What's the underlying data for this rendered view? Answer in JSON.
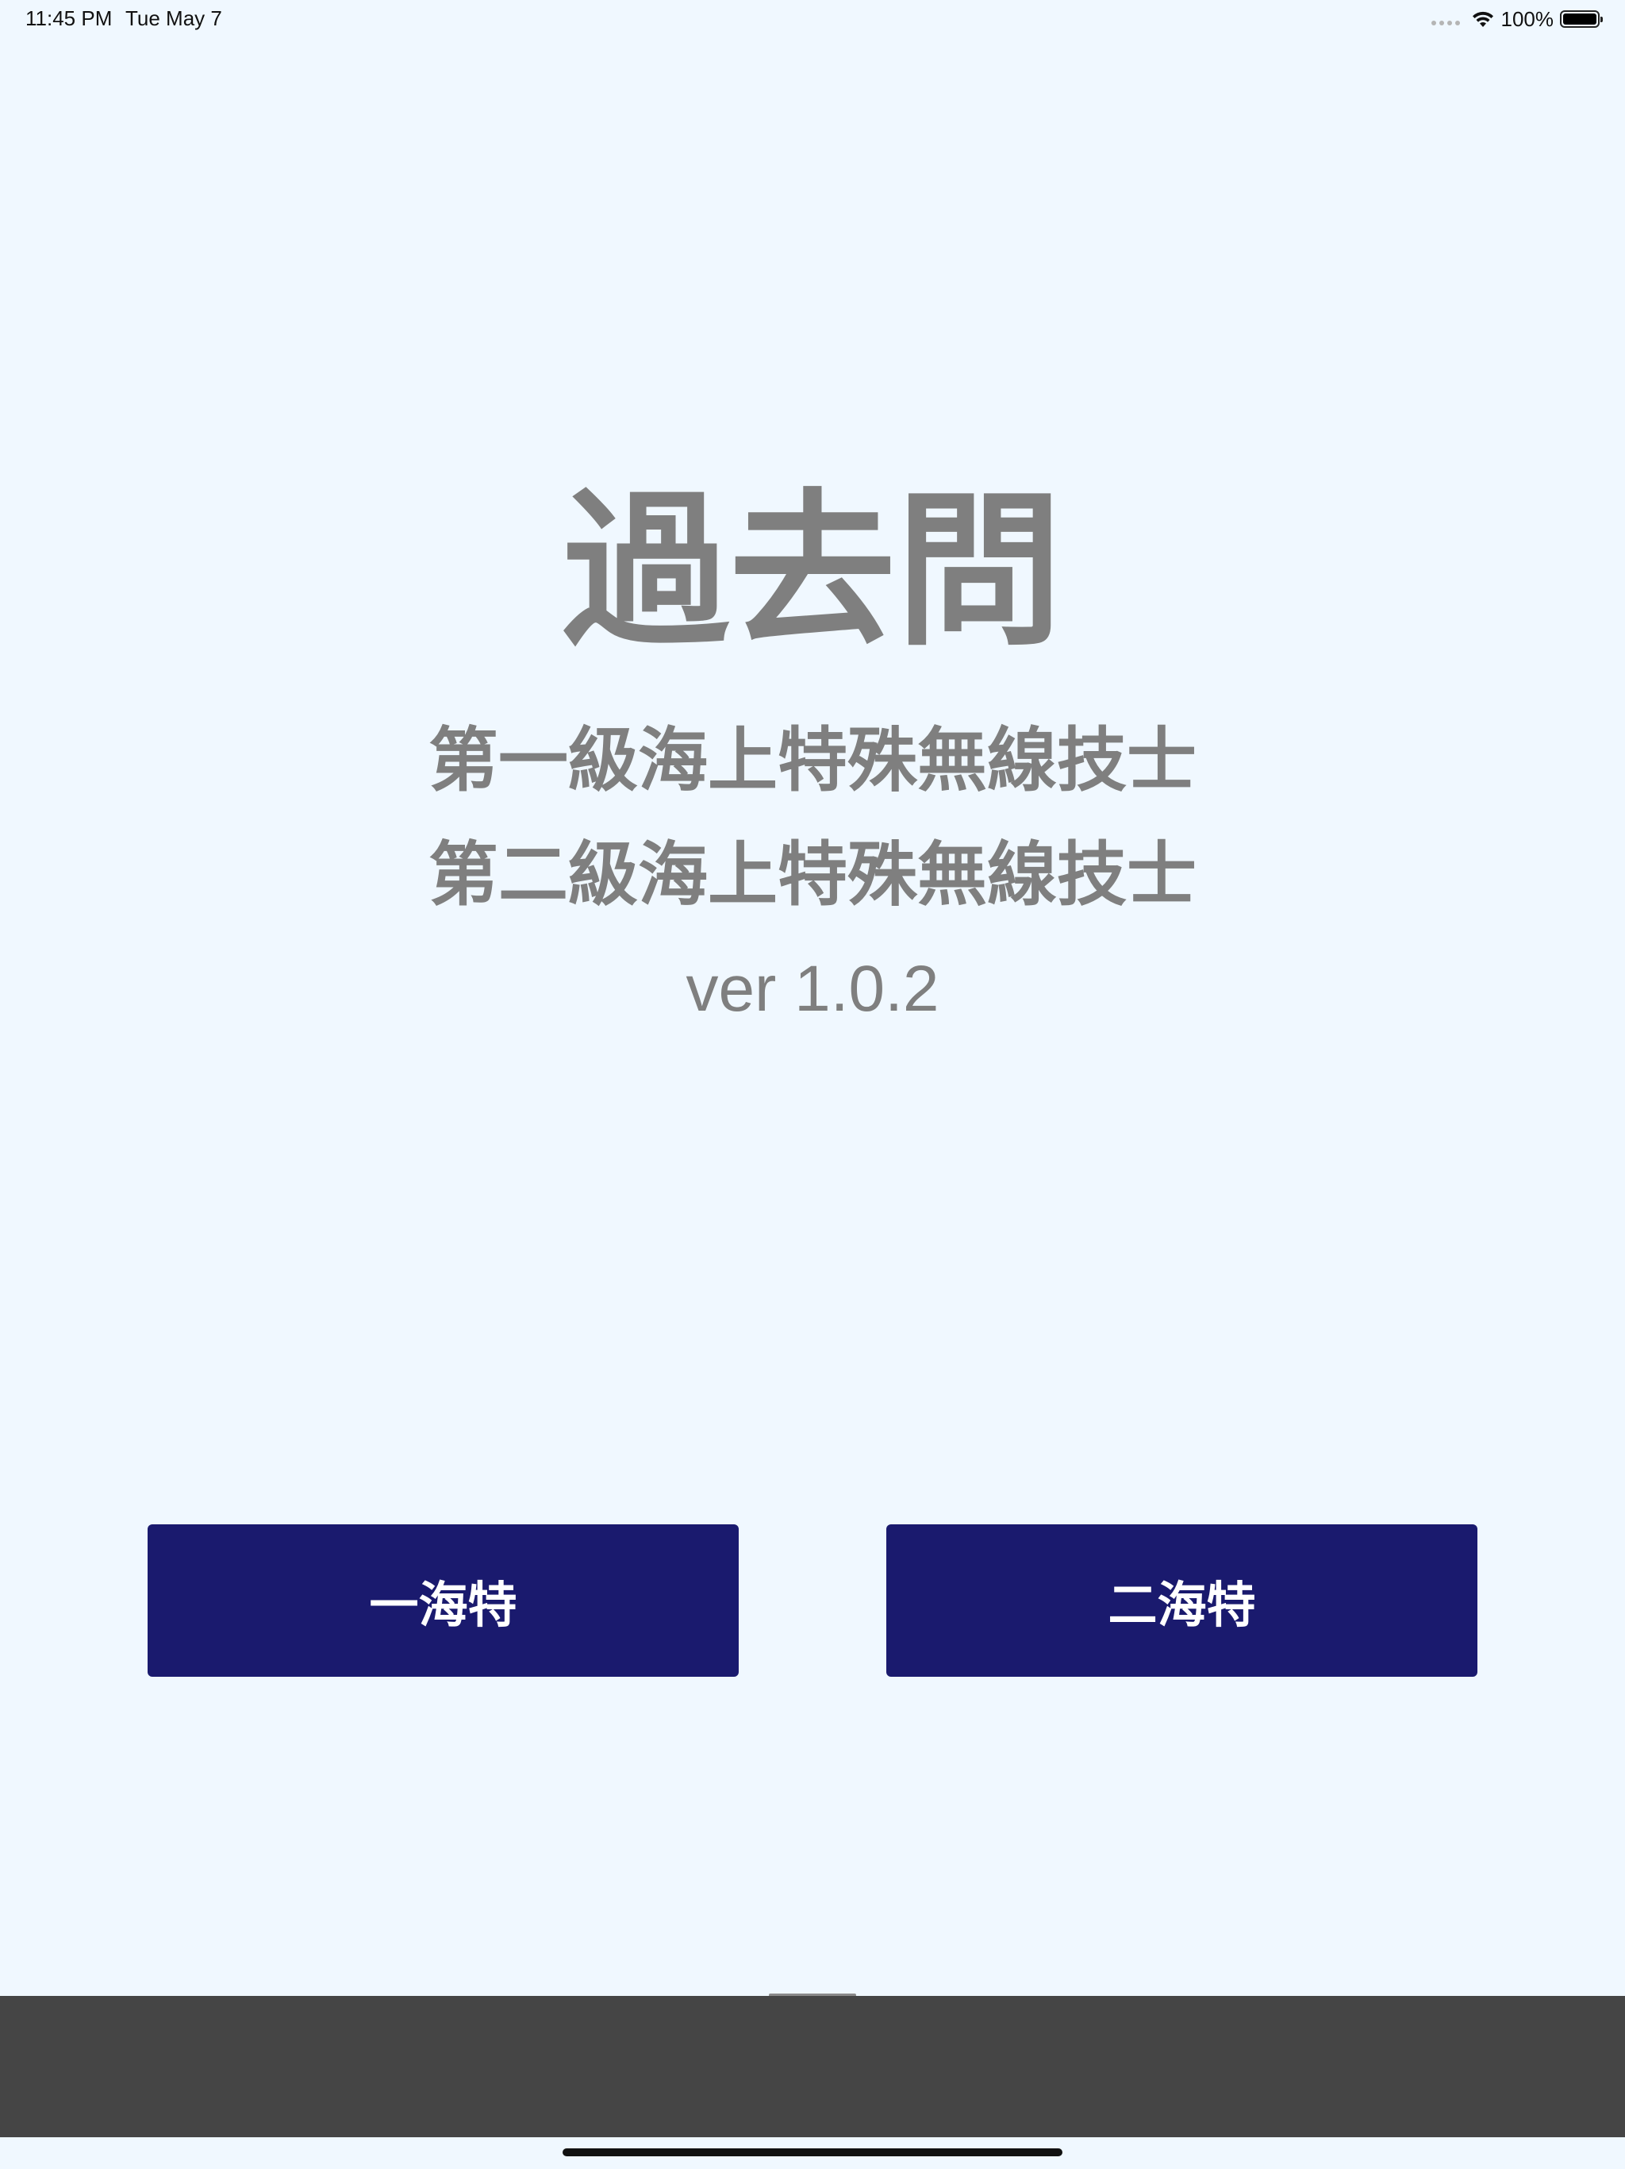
{
  "status_bar": {
    "time": "11:45 PM",
    "date": "Tue May 7",
    "battery": "100%"
  },
  "main": {
    "title": "過去問",
    "subtitle_1": "第一級海上特殊無線技士",
    "subtitle_2": "第二級海上特殊無線技士",
    "version": "ver 1.0.2"
  },
  "buttons": {
    "first_grade": "一海特",
    "second_grade": "二海特"
  },
  "colors": {
    "background": "#f0f8ff",
    "text_gray": "#7f7f7f",
    "button_navy": "#1a1a6e",
    "bottom_panel": "#454545"
  }
}
